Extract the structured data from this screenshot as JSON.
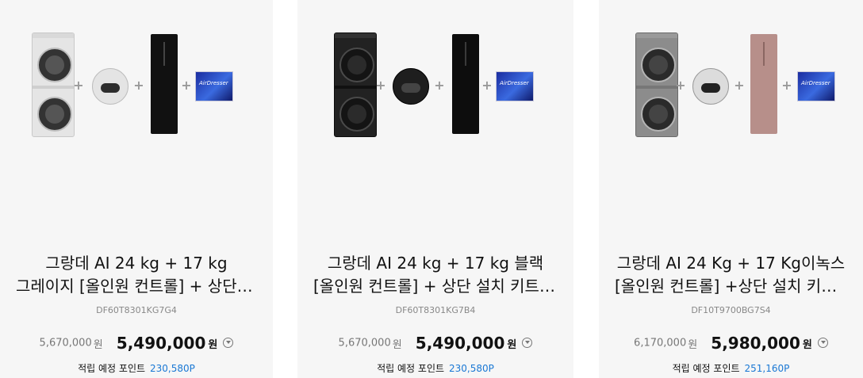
{
  "products": [
    {
      "title_line1": "그랑데 AI 24 kg + 17 kg",
      "title_line2": "그레이지 [올인원 컨트롤] + 상단 설치 키트 + 에어드레서 + 건조기 키트",
      "model": "DF60T8301KG7G4",
      "original_price": "5,670,000",
      "original_unit": "원",
      "sale_price": "5,490,000",
      "sale_unit": "원",
      "points_label": "적립 예정 포인트",
      "points_value": "230,580P",
      "kit_text": "AirDresser"
    },
    {
      "title_line1": "그랑데 AI 24 kg + 17 kg 블랙",
      "title_line2": "[올인원 컨트롤] + 상단 설치 키트 + 에어드레서 + 건조기 키트",
      "model": "DF60T8301KG7B4",
      "original_price": "5,670,000",
      "original_unit": "원",
      "sale_price": "5,490,000",
      "sale_unit": "원",
      "points_label": "적립 예정 포인트",
      "points_value": "230,580P",
      "kit_text": "AirDresser"
    },
    {
      "title_line1": "그랑데 AI 24 Kg + 17 Kg이녹스",
      "title_line2": "[올인원 컨트롤] +상단 설치 키트 + 에어드레서 + 건조기 키트",
      "model": "DF10T9700BG7S4",
      "original_price": "6,170,000",
      "original_unit": "원",
      "sale_price": "5,980,000",
      "sale_unit": "원",
      "points_label": "적립 예정 포인트",
      "points_value": "251,160P",
      "kit_text": "AirDresser"
    }
  ],
  "plus_sign": "+"
}
